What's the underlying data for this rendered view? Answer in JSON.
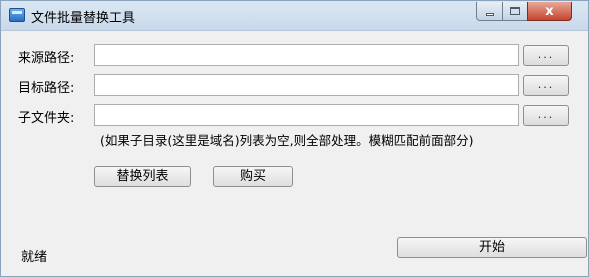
{
  "window": {
    "title": "文件批量替换工具",
    "close_glyph": "x"
  },
  "form": {
    "source_label": "来源路径:",
    "source_value": "",
    "target_label": "目标路径:",
    "target_value": "",
    "subfolder_label": "子文件夹:",
    "subfolder_value": "",
    "browse_label": "...",
    "hint": "(如果子目录(这里是域名)列表为空,则全部处理。模糊匹配前面部分)"
  },
  "actions": {
    "replace_list_label": "替换列表",
    "buy_label": "购买",
    "start_label": "开始"
  },
  "status": {
    "text": "就绪"
  }
}
